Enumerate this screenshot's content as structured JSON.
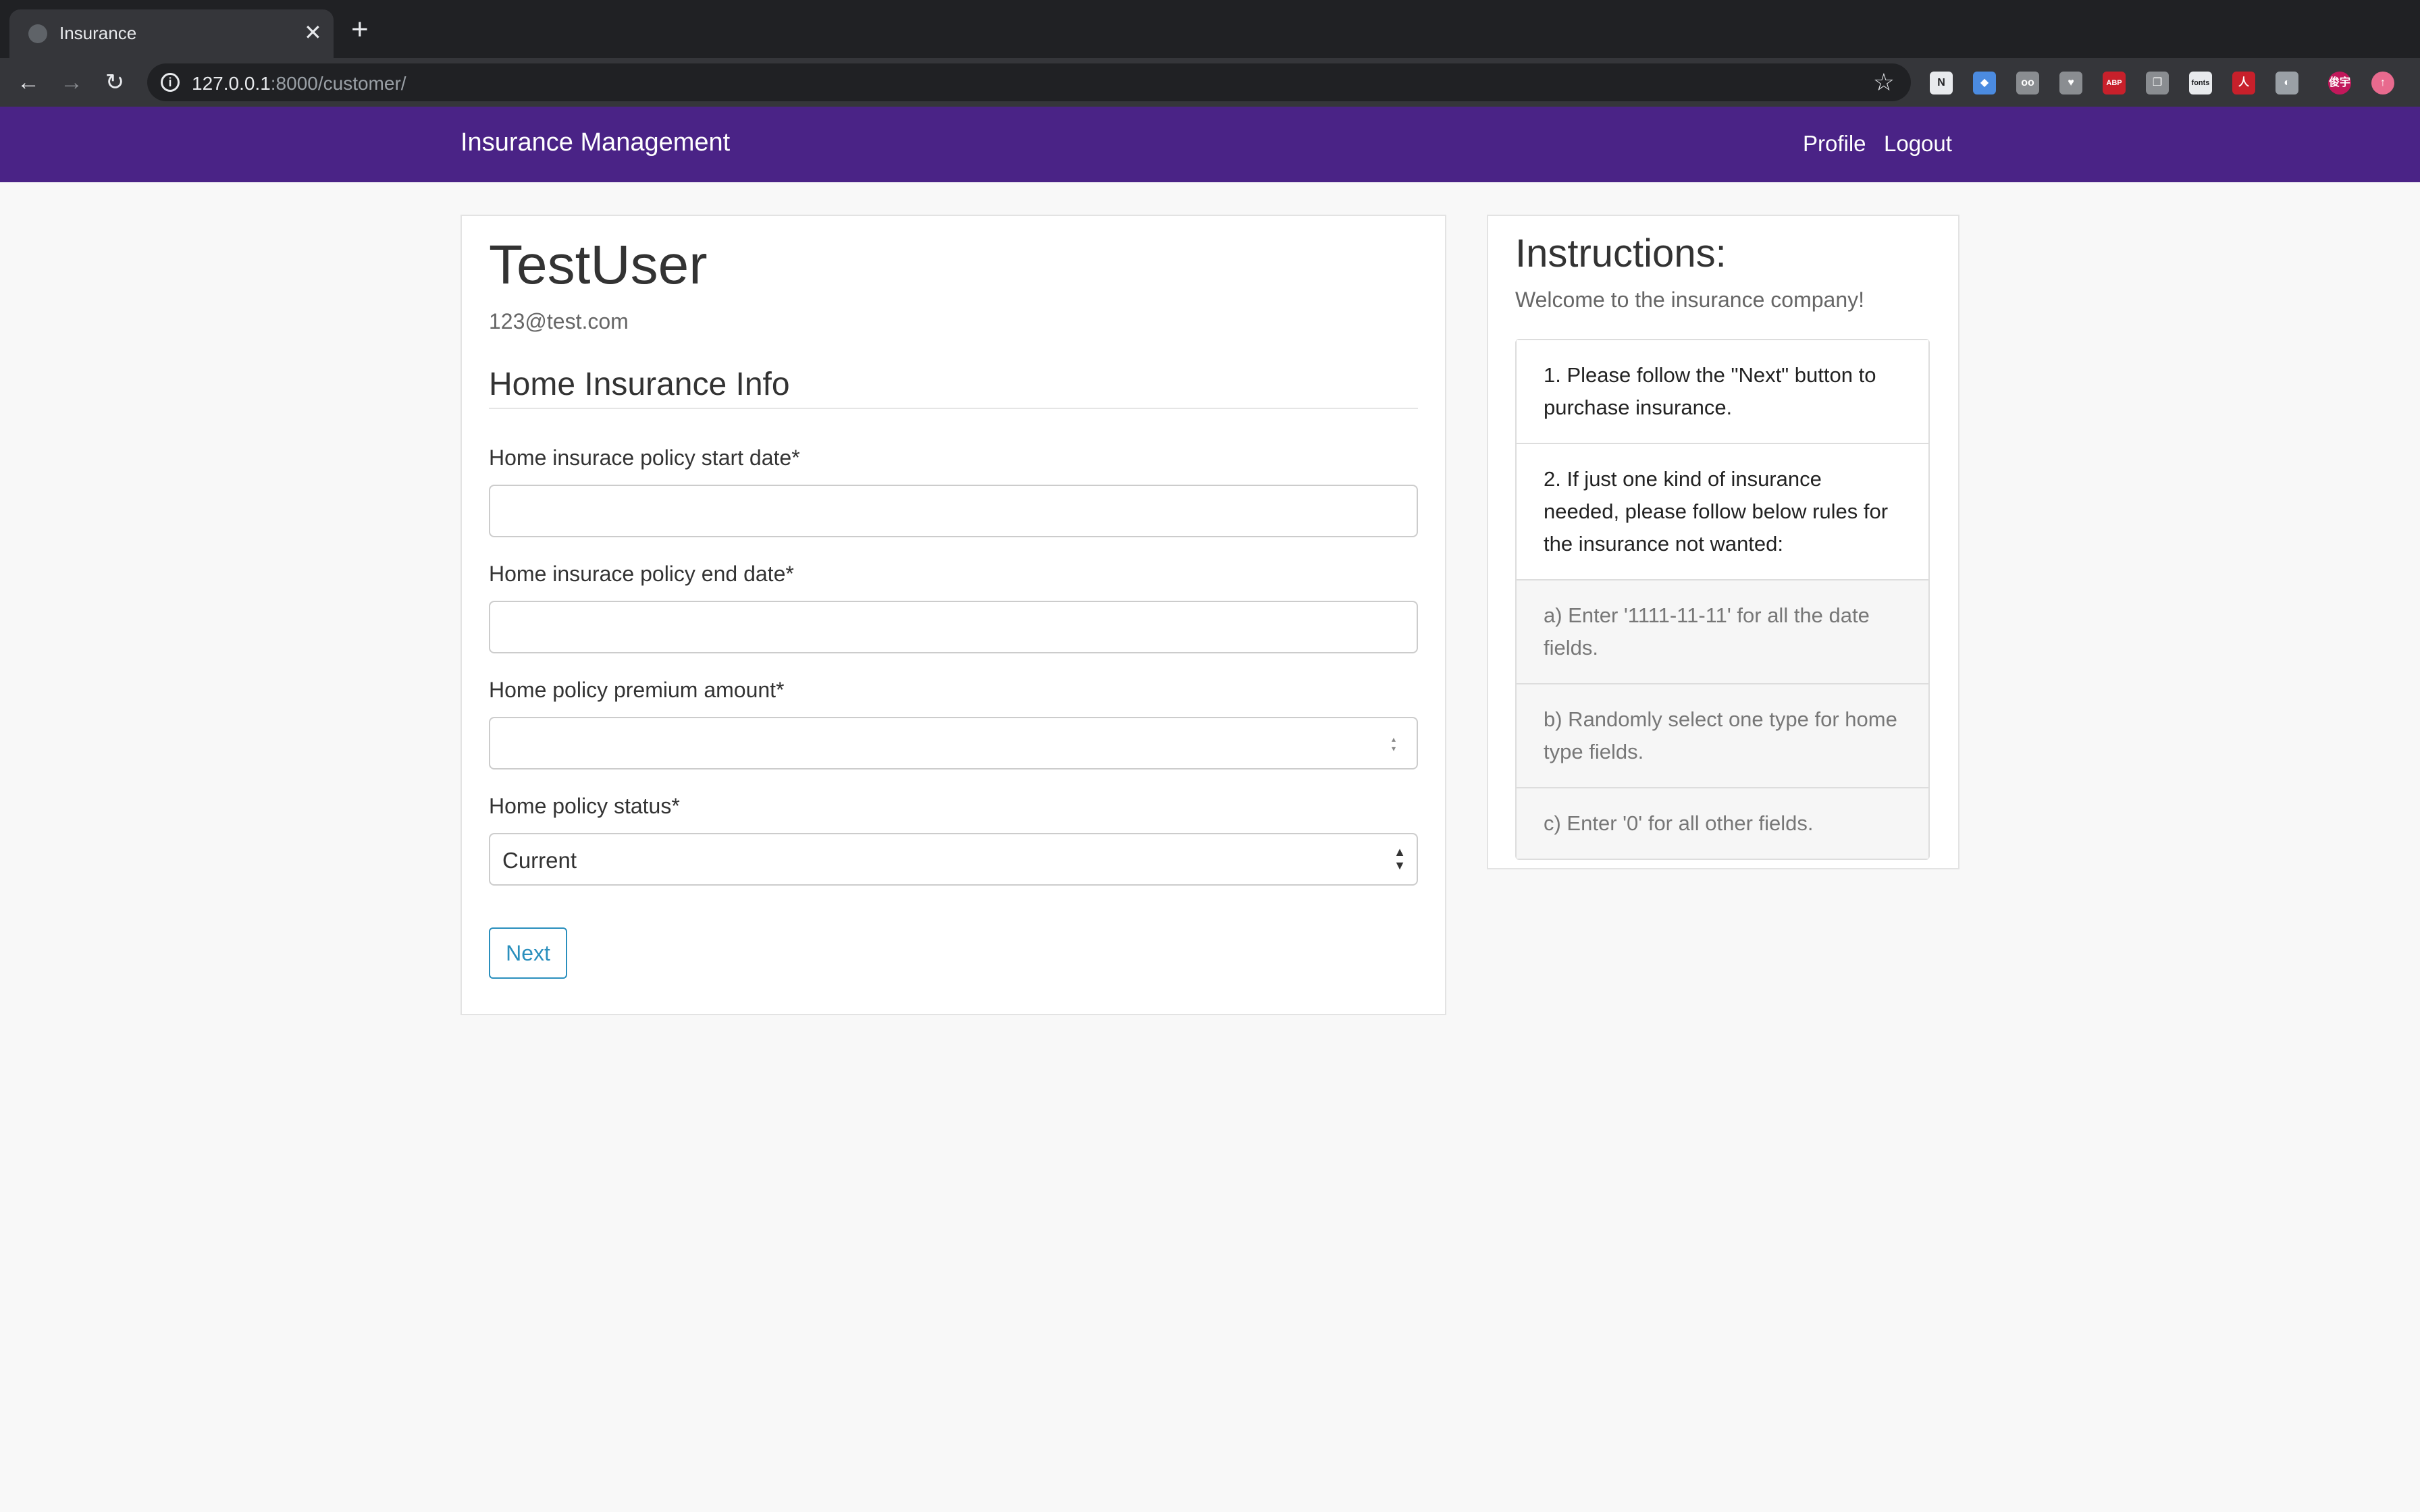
{
  "browser": {
    "tab_title": "Insurance",
    "tab_close": "✕",
    "new_tab": "+",
    "url_host": "127.0.0.1",
    "url_path": ":8000/customer/",
    "extensions": [
      {
        "name": "notion-icon",
        "label": "N",
        "color": "#e8eaed"
      },
      {
        "name": "shield-icon",
        "label": "◆",
        "color": "#4b8be0"
      },
      {
        "name": "glasses-icon",
        "label": "oo",
        "color": "#8a8d91"
      },
      {
        "name": "pocket-icon",
        "label": "♥",
        "color": "#8a8d91"
      },
      {
        "name": "adblock-icon",
        "label": "ABP",
        "color": "#c8202b"
      },
      {
        "name": "copy-icon",
        "label": "❐",
        "color": "#8a8d91"
      },
      {
        "name": "fonts-icon",
        "label": "fonts",
        "color": "#e8eaed"
      },
      {
        "name": "acrobat-icon",
        "label": "人",
        "color": "#c8202b"
      },
      {
        "name": "compass-icon",
        "label": "◐",
        "color": "#9aa0a6"
      },
      {
        "name": "profile-avatar",
        "label": "俊宇",
        "color": "#c2185b"
      },
      {
        "name": "update-icon",
        "label": "↑",
        "color": "#e86a8e"
      }
    ]
  },
  "navbar": {
    "brand": "Insurance Management",
    "links": [
      "Profile",
      "Logout"
    ],
    "color": "#4a2386"
  },
  "user": {
    "name": "TestUser",
    "email": "123@test.com"
  },
  "form": {
    "section_title": "Home Insurance Info",
    "fields": [
      {
        "label": "Home insurace policy start date*",
        "value": ""
      },
      {
        "label": "Home insurace policy end date*",
        "value": ""
      },
      {
        "label": "Home policy premium amount*",
        "value": ""
      },
      {
        "label": "Home policy status*",
        "value": "Current"
      }
    ],
    "submit_label": "Next"
  },
  "instructions": {
    "title": "Instructions:",
    "welcome": "Welcome to the insurance company!",
    "items": [
      "1. Please follow the \"Next\" button to purchase insurance.",
      "2. If just one kind of insurance needed, please follow below rules for the insurance not wanted:",
      "a) Enter '1111-11-11' for all the date fields.",
      "b) Randomly select one type for home type fields.",
      "c) Enter '0' for all other fields."
    ]
  }
}
